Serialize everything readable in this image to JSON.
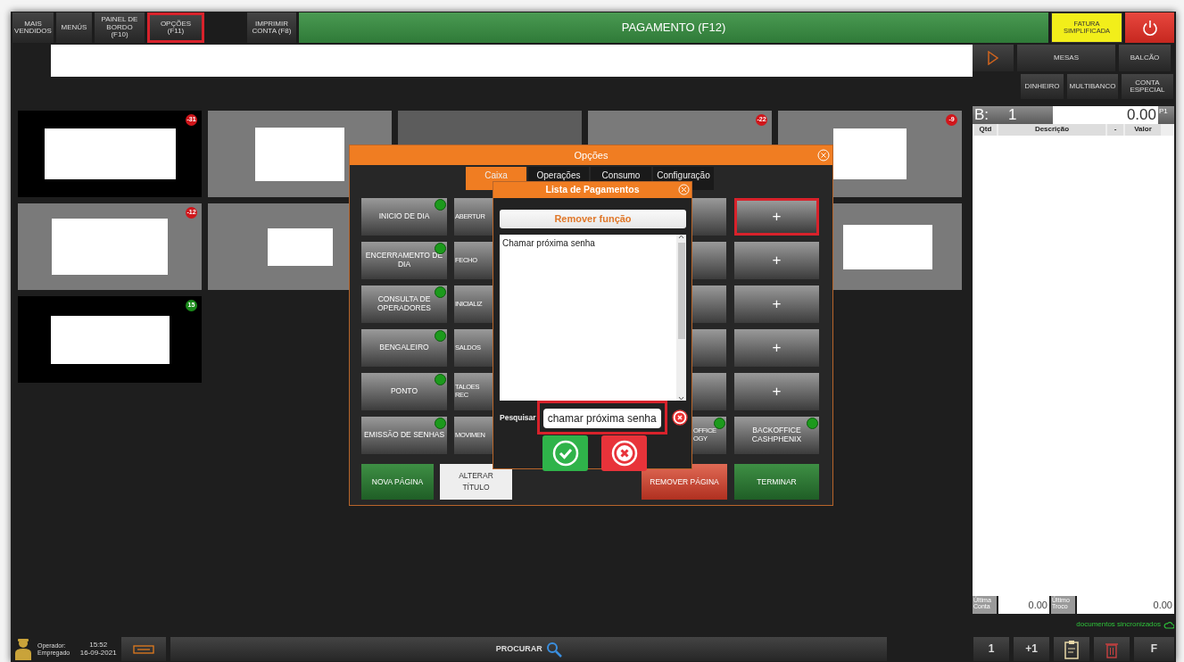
{
  "top_bar": {
    "buttons": [
      {
        "label": "MAIS\nVENDIDOS",
        "highlighted": false
      },
      {
        "label": "MENÚS",
        "highlighted": false
      },
      {
        "label": "PAINEL DE\nBORDO (F10)",
        "highlighted": false
      },
      {
        "label": "OPÇÕES\n(F11)",
        "highlighted": true
      },
      {
        "label": "IMPRIMIR\nCONTA (F8)",
        "highlighted": false
      }
    ],
    "title": "PAGAMENTO (F12)",
    "invoice_button": "FATURA\nSIMPLIFICADA"
  },
  "tiles": [
    {
      "color": "#000000",
      "blank_label": true,
      "badge": {
        "text": "-31",
        "color": "#d0161b"
      }
    },
    {
      "color": "#7a7a7a",
      "blank_label": true
    },
    {
      "color": "#5c5c5c",
      "blank_label": false
    },
    {
      "color": "#7a7a7a",
      "blank_label": false,
      "badge": {
        "text": "-22",
        "color": "#d0161b"
      }
    },
    {
      "color": "#7a7a7a",
      "blank_label": true,
      "badge": {
        "text": "-9",
        "color": "#d0161b"
      }
    },
    {
      "color": "#7a7a7a",
      "blank_label": true,
      "badge": {
        "text": "-12",
        "color": "#d0161b"
      }
    },
    {
      "color": "#7a7a7a",
      "blank_label": true
    },
    {
      "color": "#7a7a7a",
      "blank_label": true
    },
    {
      "color": "#000000",
      "blank_label": true,
      "badge": {
        "text": "15",
        "color": "#1a8a1a"
      }
    }
  ],
  "right_panel": {
    "nav_buttons": [
      "MESAS",
      "BALCÃO"
    ],
    "payment_buttons": [
      "DINHEIRO",
      "MULTIBANCO",
      "CONTA\nESPECIAL"
    ],
    "account": {
      "prefix": "B:",
      "number": "1",
      "total": "0.00",
      "price_level": "P1"
    },
    "columns": [
      "Qtd",
      "Descrição",
      "-",
      "Valor"
    ],
    "last_account": {
      "label": "Última\nConta",
      "value": "0.00"
    },
    "last_change": {
      "label": "Último\nTroco",
      "value": "0.00"
    },
    "sync_status": "documentos sincronizados",
    "keys": [
      "1",
      "+1"
    ],
    "function_key": "F"
  },
  "status_bar": {
    "operator": "Operador:\nEmpregado",
    "time": "15:52",
    "date": "16-09-2021",
    "search_button": "PROCURAR"
  },
  "options_dialog": {
    "title": "Opções",
    "tabs": [
      {
        "label": "Caixa",
        "selected": true
      },
      {
        "label": "Operações",
        "selected": false
      },
      {
        "label": "Consumo",
        "selected": false
      },
      {
        "label": "Configuração",
        "selected": false
      }
    ],
    "columns": [
      {
        "kind": "full",
        "buttons": [
          {
            "label": "INICIO DE DIA",
            "dot": true
          },
          {
            "label": "ENCERRAMENTO DE\nDIA",
            "dot": true
          },
          {
            "label": "CONSULTA DE\nOPERADORES",
            "dot": true
          },
          {
            "label": "BENGALEIRO",
            "dot": true
          },
          {
            "label": "PONTO",
            "dot": true
          },
          {
            "label": "EMISSÃO DE SENHAS",
            "dot": true
          }
        ]
      },
      {
        "kind": "stub_left",
        "buttons": [
          {
            "label": "ABERTUR"
          },
          {
            "label": "FECHO"
          },
          {
            "label": "INICIALIZ"
          },
          {
            "label": "SALDOS"
          },
          {
            "label": "TALOES\nREC"
          },
          {
            "label": "MOVIMEN"
          }
        ]
      },
      {
        "kind": "stub_right",
        "buttons": [
          {
            "dot": false
          },
          {
            "dot": false
          },
          {
            "dot": false
          },
          {
            "dot": false
          },
          {
            "dot": false
          },
          {
            "label": "OFFICE\nOGY",
            "dot": true
          }
        ]
      },
      {
        "kind": "full",
        "buttons": [
          {
            "label": "+",
            "highlighted": true
          },
          {
            "label": "+",
            "highlighted": false
          },
          {
            "label": "+",
            "highlighted": false
          },
          {
            "label": "+",
            "highlighted": false
          },
          {
            "label": "+",
            "highlighted": false
          },
          {
            "label": "BACKOFFICE\nCASHPHENIX",
            "dot": true,
            "highlighted": false
          }
        ]
      }
    ],
    "footer_buttons": [
      {
        "label": "NOVA PÁGINA",
        "kind": "green"
      },
      {
        "label": "ALTERAR TÍTULO",
        "kind": "white"
      },
      {
        "label": "REMOVER PÁGINA",
        "kind": "red"
      },
      {
        "label": "TERMINAR",
        "kind": "green"
      }
    ]
  },
  "payments_dialog": {
    "title": "Lista de Pagamentos",
    "remove_button": "Remover função",
    "items": [
      {
        "label": "Chamar próxima senha",
        "selected": false
      }
    ],
    "search": {
      "label": "Pesquisar",
      "value": "chamar próxima senha",
      "highlighted": true
    }
  }
}
